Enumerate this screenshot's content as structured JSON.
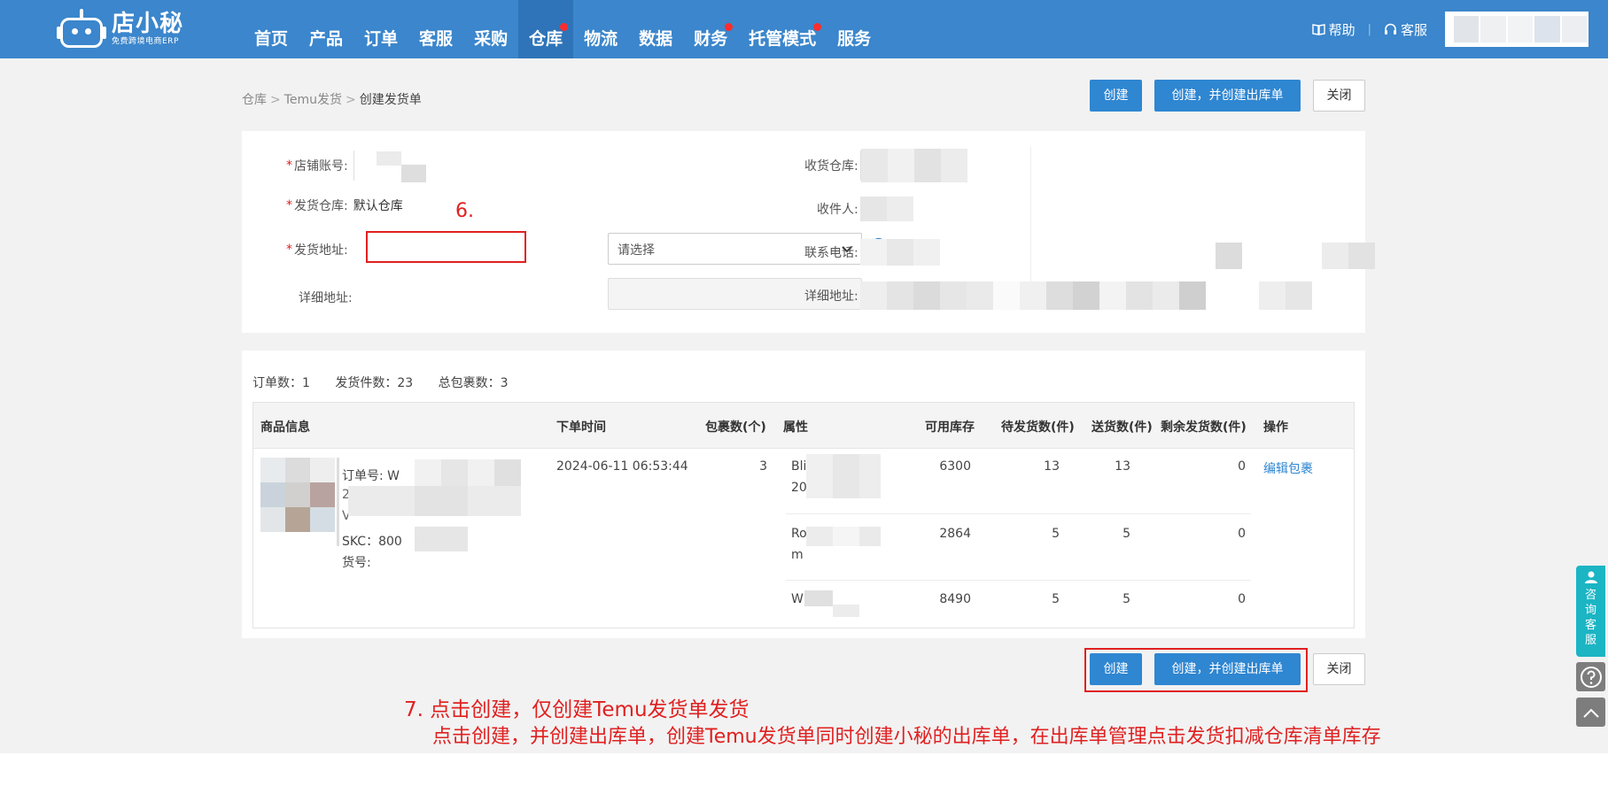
{
  "app": {
    "logo_title": "店小秘",
    "logo_sub": "免费跨境电商ERP"
  },
  "nav": {
    "items": [
      {
        "label": "首页",
        "dot": false
      },
      {
        "label": "产品",
        "dot": false
      },
      {
        "label": "订单",
        "dot": false
      },
      {
        "label": "客服",
        "dot": false
      },
      {
        "label": "采购",
        "dot": false
      },
      {
        "label": "仓库",
        "dot": true,
        "active": true
      },
      {
        "label": "物流",
        "dot": false
      },
      {
        "label": "数据",
        "dot": false
      },
      {
        "label": "财务",
        "dot": true
      },
      {
        "label": "托管模式",
        "dot": true
      },
      {
        "label": "服务",
        "dot": false
      }
    ],
    "help": "帮助",
    "service": "客服"
  },
  "breadcrumb": {
    "l1": "仓库",
    "l2": "Temu发货",
    "current": "创建发货单",
    "sep": ">"
  },
  "actions": {
    "create": "创建",
    "create_outbound": "创建，并创建出库单",
    "close": "关闭"
  },
  "form": {
    "required_mark": "*",
    "shop_account": "店铺账号:",
    "ship_warehouse": "发货仓库:",
    "ship_warehouse_value": "默认仓库",
    "ship_address": "发货地址:",
    "ship_address_placeholder": "请选择",
    "detail_address": "详细地址:",
    "recv_warehouse": "收货仓库:",
    "receiver": "收件人:",
    "phone": "联系电话:",
    "recv_detail_address": "详细地址:"
  },
  "summary": {
    "orders": "订单数：1",
    "items": "发货件数：23",
    "packages": "总包裹数：3"
  },
  "table": {
    "headers": {
      "product": "商品信息",
      "order_time": "下单时间",
      "packages": "包裹数(个)",
      "attr": "属性",
      "stock": "可用库存",
      "pending": "待发货数(件)",
      "shipped": "送货数(件)",
      "remaining": "剩余发货数(件)",
      "op": "操作"
    },
    "order_no_label": "订单号: W",
    "order_no_line2": "2",
    "order_no_line3": "V",
    "skc": "SKC：800",
    "sku_label": "货号:",
    "order_time": "2024-06-11 06:53:44",
    "packages": "3",
    "edit": "编辑包裹",
    "rows": [
      {
        "attr1": "Bli",
        "attr2": "20",
        "stock": "6300",
        "pending": "13",
        "shipped": "13",
        "remaining": "0"
      },
      {
        "attr1": "Ro",
        "attr2": "m",
        "stock": "2864",
        "pending": "5",
        "shipped": "5",
        "remaining": "0"
      },
      {
        "attr1": "Wh",
        "attr2": "",
        "stock": "8490",
        "pending": "5",
        "shipped": "5",
        "remaining": "0"
      }
    ]
  },
  "annotations": {
    "step6": "6.",
    "step7_line1": "7. 点击创建，仅创建Temu发货单发货",
    "step7_line2": "点击创建，并创建出库单，创建Temu发货单同时创建小秘的出库单，在出库单管理点击发货扣减仓库清单库存"
  },
  "float": {
    "consult": [
      "咨",
      "询",
      "客",
      "服"
    ]
  },
  "colors": {
    "nav_bg": "#3b86cc",
    "primary": "#2f86d1",
    "annotation": "#e02020",
    "consult": "#1bb5c4"
  }
}
